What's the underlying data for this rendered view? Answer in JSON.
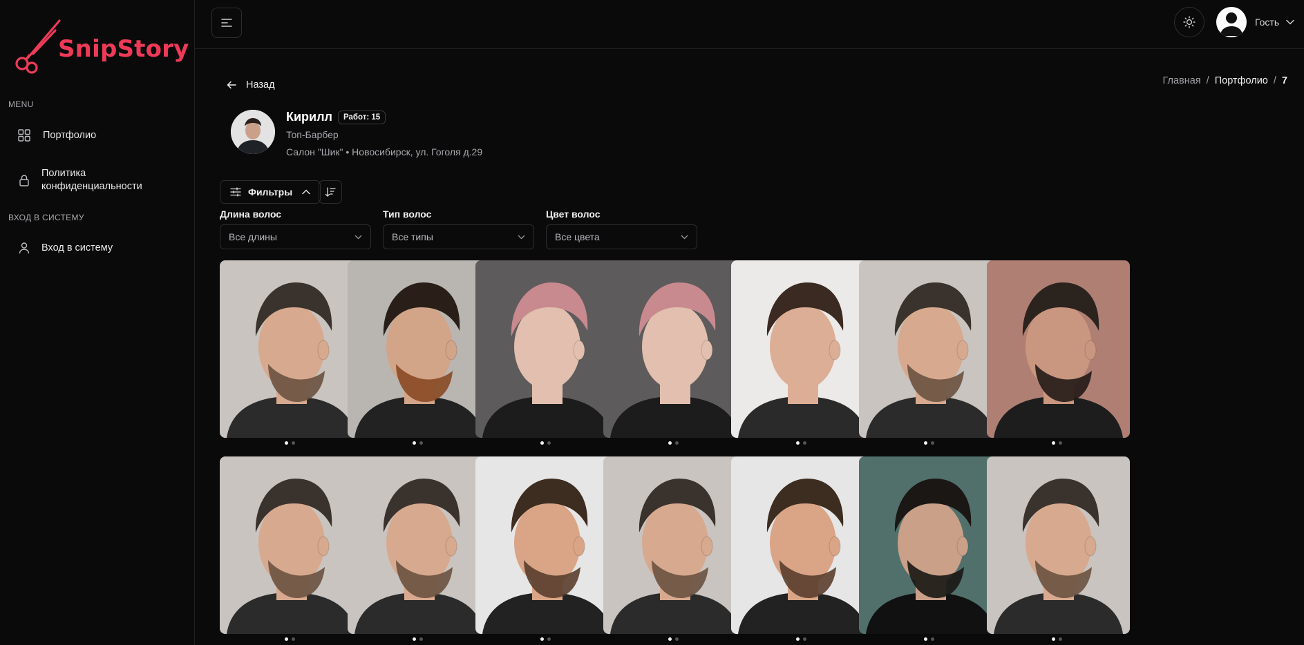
{
  "app": {
    "logo_text": "SnipStory",
    "brand_color": "#ee3a58"
  },
  "sidebar": {
    "menu_label": "MENU",
    "items": [
      {
        "label": "Портфолио",
        "icon": "grid-icon"
      },
      {
        "label_line1": "Политика",
        "label_line2": "конфиденциальности",
        "icon": "lock-icon"
      }
    ],
    "login_section_label": "ВХОД В СИСТЕМУ",
    "login_item": {
      "label": "Вход в систему",
      "icon": "user-icon"
    }
  },
  "topbar": {
    "user_name": "Гость"
  },
  "breadcrumb": {
    "home": "Главная",
    "sep": "/",
    "portfolio": "Портфолио",
    "current": "7"
  },
  "back_label": "Назад",
  "profile": {
    "name": "Кирилл",
    "works_badge": "Работ: 15",
    "role": "Топ-Барбер",
    "salon": "Салон \"Шик\" • Новосибирск, ул. Гоголя д.29"
  },
  "filters": {
    "button_label": "Фильтры",
    "length": {
      "label": "Длина волос",
      "value": "Все длины"
    },
    "type": {
      "label": "Тип волос",
      "value": "Все типы"
    },
    "color": {
      "label": "Цвет волос",
      "value": "Все цвета"
    }
  },
  "gallery": {
    "rows": [
      [
        "fade-man",
        "beard-man",
        "pink-woman",
        "pink-woman",
        "pompadour-man",
        "fade-man",
        "beard-brick"
      ],
      [
        "fade-man",
        "fade-man",
        "crop-man",
        "fade-man",
        "crop-man",
        "curly-beard",
        "fade-man"
      ]
    ]
  }
}
